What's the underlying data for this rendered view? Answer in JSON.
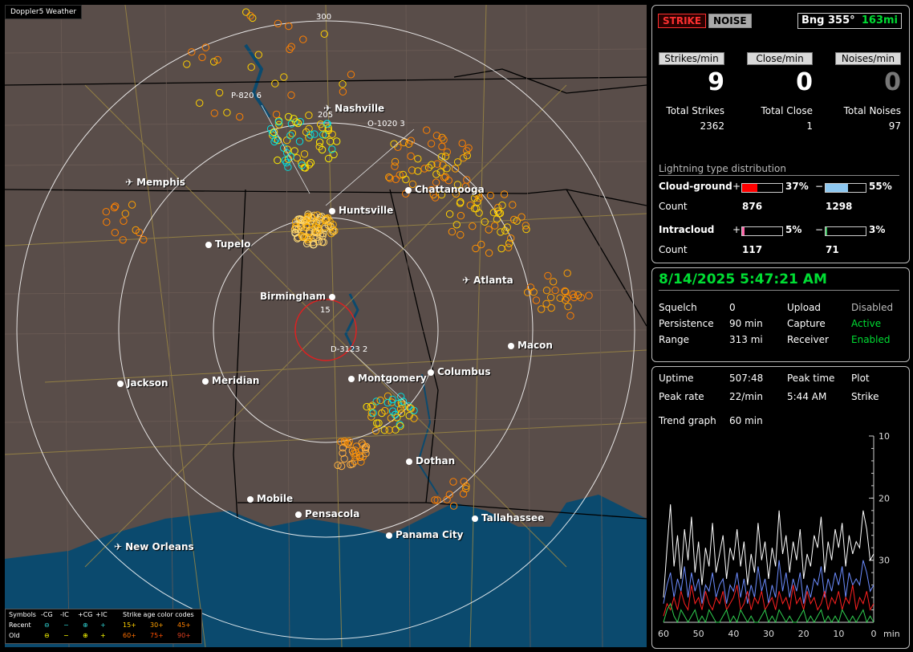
{
  "app": {
    "title": "Doppler5 Weather"
  },
  "map": {
    "range_labels": [
      "300",
      "205",
      "15"
    ],
    "cities": [
      {
        "name": "Nashville",
        "kind": "plane"
      },
      {
        "name": "Memphis",
        "kind": "plane"
      },
      {
        "name": "Chattanooga",
        "kind": "dot"
      },
      {
        "name": "Huntsville",
        "kind": "dot"
      },
      {
        "name": "Tupelo",
        "kind": "dot"
      },
      {
        "name": "Atlanta",
        "kind": "plane"
      },
      {
        "name": "Birmingham",
        "kind": "dot"
      },
      {
        "name": "Macon",
        "kind": "dot"
      },
      {
        "name": "Jackson",
        "kind": "dot"
      },
      {
        "name": "Meridian",
        "kind": "dot"
      },
      {
        "name": "Montgomery",
        "kind": "dot"
      },
      {
        "name": "Columbus",
        "kind": "dot"
      },
      {
        "name": "Dothan",
        "kind": "dot"
      },
      {
        "name": "Mobile",
        "kind": "dot"
      },
      {
        "name": "Pensacola",
        "kind": "dot"
      },
      {
        "name": "Tallahassee",
        "kind": "dot"
      },
      {
        "name": "Panama City",
        "kind": "dot"
      },
      {
        "name": "New Orleans",
        "kind": "plane"
      }
    ],
    "flags": [
      "P-820 6",
      "O-1020 3",
      "D-3123 2"
    ],
    "legend": {
      "symbols_label": "Symbols",
      "cols": [
        "-CG",
        "-IC",
        "+CG",
        "+IC"
      ],
      "recent": "Recent",
      "old": "Old",
      "age_title": "Strike age color codes",
      "ages_recent": [
        "15+",
        "30+",
        "45+"
      ],
      "ages_old": [
        "60+",
        "75+",
        "90+"
      ]
    }
  },
  "status": {
    "strike_btn": "STRIKE",
    "noise_btn": "NOISE",
    "bearing": "Bng 355°",
    "distance": "163mi",
    "rates": [
      {
        "label": "Strikes/min",
        "value": "9"
      },
      {
        "label": "Close/min",
        "value": "0"
      },
      {
        "label": "Noises/min",
        "value": "0"
      }
    ],
    "totals": [
      {
        "label": "Total Strikes",
        "value": "2362"
      },
      {
        "label": "Total Close",
        "value": "1"
      },
      {
        "label": "Total Noises",
        "value": "97"
      }
    ],
    "dist_title": "Lightning type distribution",
    "cg_label": "Cloud-ground",
    "ic_label": "Intracloud",
    "count_label": "Count",
    "cg_pos": {
      "sign": "+",
      "pct": "37%",
      "frac": 0.37,
      "count": "876",
      "color": "#ff0000"
    },
    "cg_neg": {
      "sign": "−",
      "pct": "55%",
      "frac": 0.55,
      "count": "1298",
      "color": "#8ec8f0"
    },
    "ic_pos": {
      "sign": "+",
      "pct": "5%",
      "frac": 0.05,
      "count": "117",
      "color": "#ff66aa"
    },
    "ic_neg": {
      "sign": "−",
      "pct": "3%",
      "frac": 0.03,
      "count": "71",
      "color": "#40c060"
    }
  },
  "settings": {
    "datetime": "8/14/2025 5:47:21 AM",
    "rows": [
      [
        "Squelch",
        "0",
        "Upload",
        "Disabled"
      ],
      [
        "Persistence",
        "90 min",
        "Capture",
        "Active"
      ],
      [
        "Range",
        "313 mi",
        "Receiver",
        "Enabled"
      ]
    ]
  },
  "trend": {
    "uptime_label": "Uptime",
    "uptime": "507:48",
    "peak_time_label": "Peak time",
    "plot_label": "Plot",
    "peak_rate_label": "Peak rate",
    "peak_rate": "22/min",
    "peak_time": "5:44 AM",
    "plot": "Strike",
    "graph_label": "Trend graph",
    "graph_span": "60 min",
    "x_ticks": [
      "60",
      "50",
      "40",
      "30",
      "20",
      "10",
      "0"
    ],
    "x_unit": "min",
    "y_ticks": [
      "30",
      "20",
      "10"
    ]
  },
  "chart_data": {
    "type": "line",
    "title": "",
    "xlabel": "min",
    "ylabel": "",
    "xlim": [
      60,
      0
    ],
    "ylim": [
      0,
      30
    ],
    "x_ticks": [
      60,
      50,
      40,
      30,
      20,
      10,
      0
    ],
    "y_ticks": [
      10,
      20,
      30
    ],
    "series": [
      {
        "color": "#ffffff",
        "values": [
          4,
          12,
          19,
          9,
          14,
          7,
          15,
          10,
          17,
          8,
          13,
          6,
          12,
          9,
          16,
          8,
          11,
          14,
          7,
          12,
          10,
          15,
          9,
          13,
          6,
          11,
          8,
          16,
          10,
          13,
          7,
          12,
          9,
          18,
          11,
          14,
          8,
          13,
          10,
          15,
          7,
          11,
          9,
          14,
          12,
          17,
          8,
          13,
          10,
          15,
          12,
          16,
          9,
          14,
          11,
          13,
          12,
          18,
          15,
          10,
          11
        ]
      },
      {
        "color": "#6c8cff",
        "values": [
          3,
          6,
          8,
          4,
          7,
          5,
          9,
          4,
          8,
          5,
          7,
          3,
          6,
          5,
          8,
          4,
          6,
          7,
          3,
          6,
          5,
          8,
          4,
          7,
          3,
          6,
          4,
          9,
          5,
          7,
          3,
          6,
          4,
          10,
          5,
          8,
          4,
          7,
          5,
          8,
          3,
          6,
          4,
          7,
          6,
          9,
          4,
          7,
          5,
          8,
          6,
          9,
          4,
          8,
          6,
          7,
          6,
          10,
          8,
          5,
          6
        ]
      },
      {
        "color": "#ff2020",
        "values": [
          1,
          3,
          2,
          4,
          2,
          5,
          3,
          2,
          6,
          3,
          4,
          2,
          5,
          3,
          2,
          4,
          3,
          5,
          2,
          3,
          4,
          6,
          2,
          3,
          5,
          2,
          4,
          3,
          5,
          2,
          3,
          4,
          2,
          5,
          3,
          4,
          2,
          6,
          3,
          4,
          2,
          5,
          3,
          4,
          2,
          3,
          5,
          2,
          4,
          3,
          5,
          2,
          4,
          3,
          6,
          2,
          4,
          3,
          5,
          2,
          3
        ]
      },
      {
        "color": "#30d050",
        "values": [
          0,
          2,
          3,
          1,
          0,
          2,
          1,
          0,
          1,
          2,
          0,
          1,
          0,
          2,
          1,
          0,
          0,
          1,
          2,
          0,
          1,
          0,
          2,
          1,
          0,
          1,
          0,
          0,
          1,
          2,
          0,
          1,
          0,
          2,
          1,
          0,
          1,
          0,
          0,
          1,
          2,
          0,
          1,
          0,
          1,
          2,
          0,
          1,
          0,
          1,
          0,
          2,
          1,
          0,
          1,
          0,
          1,
          2,
          0,
          1,
          0
        ]
      }
    ]
  },
  "colors": {
    "panel_border": "#bbbbbb",
    "map_bg": "#594d49",
    "water": "#0b4a6e",
    "accent_green": "#00dd33",
    "strike_red": "#ff3030"
  }
}
